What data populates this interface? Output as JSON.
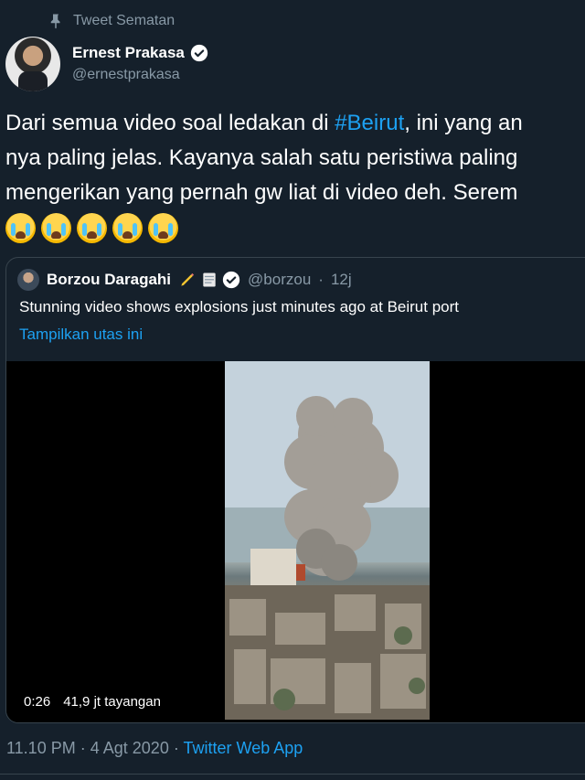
{
  "pinned": {
    "label": "Tweet Sematan"
  },
  "author": {
    "name": "Ernest Prakasa",
    "handle": "@ernestprakasa"
  },
  "tweet": {
    "text_before": "Dari semua video soal ledakan di ",
    "hashtag": "#Beirut",
    "text_after": ", ini yang an",
    "line2": "nya paling jelas. Kayanya salah satu peristiwa paling",
    "line3": "mengerikan yang pernah gw liat di video deh. Serem",
    "emoji_count": 5,
    "emoji_name": "loudly-crying-face"
  },
  "quoted": {
    "name": "Borzou Daragahi",
    "handle": "@borzou",
    "separator": "·",
    "time": "12j",
    "text": "Stunning video shows explosions just minutes ago at Beirut port",
    "show_thread": "Tampilkan utas ini",
    "video": {
      "duration": "0:26",
      "views": "41,9 jt tayangan"
    }
  },
  "meta": {
    "time": "11.10 PM",
    "separator": "·",
    "date": "4 Agt 2020",
    "source": "Twitter Web App"
  },
  "colors": {
    "background": "#15202b",
    "accent": "#1da1f2",
    "muted": "#8899a6",
    "border": "#38444d"
  }
}
